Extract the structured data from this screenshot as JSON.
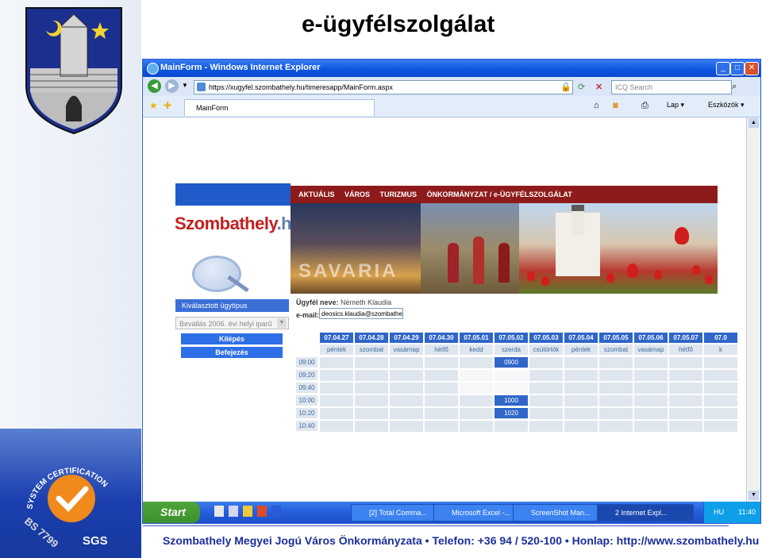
{
  "slide": {
    "title": "e-ügyfélszolgálat",
    "footer": "Szombathely Megyei Jogú Város Önkormányzata • Telefon: +36 94 / 520-100 • Honlap: http://www.szombathely.hu"
  },
  "cert": {
    "ring_text": "SYSTEM CERTIFICATION",
    "standard": "BS 7799",
    "brand": "SGS"
  },
  "browser": {
    "title": "MainForm - Windows Internet Explorer",
    "url": "https://xugyfel.szombathely.hu/timeresapp/MainForm.aspx",
    "search_placeholder": "ICQ Search",
    "tab_label": "MainForm",
    "toolbar": {
      "page_label": "Lap",
      "tools_label": "Eszközök"
    }
  },
  "taskbar": {
    "start_label": "Start",
    "tasks": [
      "[2] Total Comma...",
      "Microsoft Excel -...",
      "ScreenShot Man...",
      "2 Internet Expl..."
    ],
    "lang": "HU",
    "clock": "11:40"
  },
  "page": {
    "logo_text": "Szombathely",
    "logo_suffix": ".hu",
    "nav": [
      "AKTUÁLIS",
      "VÁROS",
      "TURIZMUS",
      "ÖNKORMÁNYZAT / e-ÜGYFÉLSZOLGÁLAT"
    ],
    "banner_text": "SAVARIA",
    "selected_case_label": "Kiválasztott ügytípus",
    "case_value": "Bevallás 2006. évi helyi iparű",
    "logout_label": "Kilépés",
    "finish_label": "Befejezés",
    "client_label": "Ügyfél neve:",
    "client_name": "Németh Klaudia",
    "email_label": "e-mail:",
    "email_value": "deosics.klaudia@szombathely"
  },
  "schedule": {
    "dates": [
      "07.04.27",
      "07.04.28",
      "07.04.29",
      "07.04.30",
      "07.05.01",
      "07.05.02",
      "07.05.03",
      "07.05.04",
      "07.05.05",
      "07.05.06",
      "07.05.07",
      "07.0"
    ],
    "days": [
      "péntek",
      "szombat",
      "vasárnap",
      "hétfő",
      "kedd",
      "szerda",
      "csütörtök",
      "péntek",
      "szombat",
      "vasárnap",
      "hétfő",
      "k"
    ],
    "times": [
      "09:00",
      "09:20",
      "09:40",
      "10:00",
      "10:20",
      "10:40"
    ],
    "booked": [
      {
        "day": 5,
        "time": 0,
        "label": "0900"
      },
      {
        "day": 5,
        "time": 3,
        "label": "1000"
      },
      {
        "day": 5,
        "time": 4,
        "label": "1020"
      }
    ]
  }
}
